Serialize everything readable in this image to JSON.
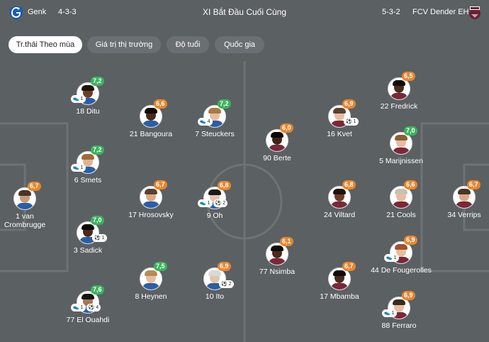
{
  "header": {
    "home_team": "Genk",
    "home_formation": "4-3-3",
    "title": "XI Bắt Đầu Cuối Cùng",
    "away_formation": "5-3-2",
    "away_team": "FCV Dender EH"
  },
  "tabs": [
    {
      "label": "Tr.thái Theo mùa",
      "active": true
    },
    {
      "label": "Giá trị thị trường",
      "active": false
    },
    {
      "label": "Độ tuổi",
      "active": false
    },
    {
      "label": "Quốc gia",
      "active": false
    }
  ],
  "colors": {
    "background": "#5b6063",
    "rating_high": "#3cb35d",
    "rating_mid": "#e8862c",
    "tab_active": "#ffffff"
  },
  "home_players": [
    {
      "number": "1",
      "name": "van Crombrugge",
      "rating": "6,7",
      "rating_color": "orange",
      "skin": "#c99a7a",
      "hair": "#4a3426",
      "shirt": "#2a5ea8"
    },
    {
      "number": "18",
      "name": "Ditu",
      "rating": "7,2",
      "rating_color": "green",
      "skin": "#6b3f2a",
      "hair": "#1e120c",
      "shirt": "#2a5ea8",
      "events": [
        "boot 1"
      ]
    },
    {
      "number": "6",
      "name": "Smets",
      "rating": "7,2",
      "rating_color": "green",
      "skin": "#e1b48f",
      "hair": "#9c6b3a",
      "shirt": "#2a5ea8",
      "events": [
        "boot 1"
      ]
    },
    {
      "number": "3",
      "name": "Sadick",
      "rating": "7,0",
      "rating_color": "green",
      "skin": "#4a2a1b",
      "hair": "#120a06",
      "shirt": "#2a5ea8",
      "events": [
        "goal 1"
      ]
    },
    {
      "number": "77",
      "name": "El Ouahdi",
      "rating": "7,6",
      "rating_color": "green",
      "skin": "#a57654",
      "hair": "#1a120d",
      "shirt": "#2a5ea8",
      "events": [
        "boot 1",
        "goal 4"
      ]
    },
    {
      "number": "21",
      "name": "Bangoura",
      "rating": "6,6",
      "rating_color": "orange",
      "skin": "#4a2a1b",
      "hair": "#120a06",
      "shirt": "#2a5ea8"
    },
    {
      "number": "17",
      "name": "Hrosovsky",
      "rating": "6,7",
      "rating_color": "orange",
      "skin": "#d9a988",
      "hair": "#5b4030",
      "shirt": "#2a5ea8"
    },
    {
      "number": "8",
      "name": "Heynen",
      "rating": "7,5",
      "rating_color": "green",
      "skin": "#e6bda0",
      "hair": "#b88a5a",
      "shirt": "#2a5ea8"
    },
    {
      "number": "7",
      "name": "Steuckers",
      "rating": "7,2",
      "rating_color": "green",
      "skin": "#e6bda0",
      "hair": "#a87a45",
      "shirt": "#2a5ea8",
      "events": [
        "boot 4"
      ]
    },
    {
      "number": "9",
      "name": "Oh",
      "rating": "6,8",
      "rating_color": "orange",
      "skin": "#e3c4a8",
      "hair": "#1a1a1a",
      "shirt": "#2a5ea8",
      "events": [
        "boot 1",
        "goal 2"
      ]
    },
    {
      "number": "10",
      "name": "Ito",
      "rating": "6,9",
      "rating_color": "orange",
      "skin": "#e3c4a8",
      "hair": "#d8d8d8",
      "shirt": "#2a5ea8",
      "events": [
        "goal 2"
      ]
    }
  ],
  "away_players": [
    {
      "number": "34",
      "name": "Verrips",
      "rating": "6,7",
      "rating_color": "orange",
      "skin": "#d9a988",
      "hair": "#4a3426",
      "shirt": "#7a2838"
    },
    {
      "number": "22",
      "name": "Fredrick",
      "rating": "6,5",
      "rating_color": "orange",
      "skin": "#4a2a1b",
      "hair": "#120a06",
      "shirt": "#7a2838"
    },
    {
      "number": "5",
      "name": "Marijnissen",
      "rating": "7,0",
      "rating_color": "green",
      "skin": "#e6bda0",
      "hair": "#8a5e34",
      "shirt": "#7a2838"
    },
    {
      "number": "21",
      "name": "Cools",
      "rating": "6,6",
      "rating_color": "orange",
      "skin": "#e6bda0",
      "hair": "#c9c0b0",
      "shirt": "#7a2838"
    },
    {
      "number": "44",
      "name": "De Fougerolles",
      "rating": "6,9",
      "rating_color": "orange",
      "skin": "#e6bda0",
      "hair": "#a0522d",
      "shirt": "#7a2838",
      "events": [
        "boot 1"
      ]
    },
    {
      "number": "88",
      "name": "Ferraro",
      "rating": "6,9",
      "rating_color": "orange",
      "skin": "#e6bda0",
      "hair": "#3a2a20",
      "shirt": "#7a2838",
      "events": [
        "boot 1"
      ]
    },
    {
      "number": "16",
      "name": "Kvet",
      "rating": "6,9",
      "rating_color": "orange",
      "skin": "#e6bda0",
      "hair": "#5a4030",
      "shirt": "#7a2838",
      "events": [
        "goal 1"
      ]
    },
    {
      "number": "24",
      "name": "Viltard",
      "rating": "6,8",
      "rating_color": "orange",
      "skin": "#6b3f2a",
      "hair": "#1e120c",
      "shirt": "#7a2838"
    },
    {
      "number": "17",
      "name": "Mbamba",
      "rating": "6,7",
      "rating_color": "orange",
      "skin": "#4a2a1b",
      "hair": "#120a06",
      "shirt": "#7a2838"
    },
    {
      "number": "90",
      "name": "Berte",
      "rating": "6,0",
      "rating_color": "orange",
      "skin": "#3e2418",
      "hair": "#0e0805",
      "shirt": "#7a2838"
    },
    {
      "number": "77",
      "name": "Nsimba",
      "rating": "6,1",
      "rating_color": "orange",
      "skin": "#4a2a1b",
      "hair": "#120a06",
      "shirt": "#7a2838"
    }
  ]
}
